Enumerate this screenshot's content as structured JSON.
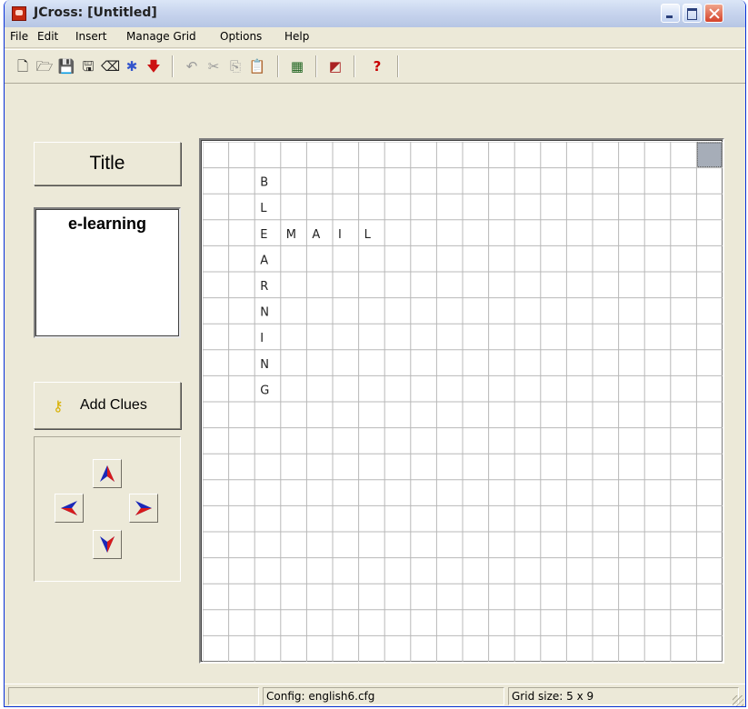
{
  "window": {
    "title": "JCross: [Untitled]"
  },
  "menu": [
    "File",
    "Edit",
    "Insert",
    "Manage Grid",
    "Options",
    "Help"
  ],
  "toolbar": {
    "icons": [
      "new-file-icon",
      "open-folder-icon",
      "save-icon",
      "save-as-icon",
      "eraser-icon",
      "web-export-icon",
      "export-arrow-icon",
      "undo-icon",
      "cut-icon",
      "copy-icon",
      "paste-icon",
      "grid-icon",
      "configuration-icon",
      "help-icon"
    ]
  },
  "left_panel": {
    "title_button": "Title",
    "title_value": "e-learning",
    "add_clues_label": "Add Clues",
    "arrows": [
      "up-arrow-icon",
      "left-arrow-icon",
      "right-arrow-icon",
      "down-arrow-icon"
    ]
  },
  "grid": {
    "rows": 20,
    "cols": 20,
    "letters": [
      {
        "r": 1,
        "c": 2,
        "ch": "B"
      },
      {
        "r": 2,
        "c": 2,
        "ch": "L"
      },
      {
        "r": 3,
        "c": 2,
        "ch": "E"
      },
      {
        "r": 3,
        "c": 3,
        "ch": "M"
      },
      {
        "r": 3,
        "c": 4,
        "ch": "A"
      },
      {
        "r": 3,
        "c": 5,
        "ch": "I"
      },
      {
        "r": 3,
        "c": 6,
        "ch": "L"
      },
      {
        "r": 4,
        "c": 2,
        "ch": "A"
      },
      {
        "r": 5,
        "c": 2,
        "ch": "R"
      },
      {
        "r": 6,
        "c": 2,
        "ch": "N"
      },
      {
        "r": 7,
        "c": 2,
        "ch": "I"
      },
      {
        "r": 8,
        "c": 2,
        "ch": "N"
      },
      {
        "r": 9,
        "c": 2,
        "ch": "G"
      }
    ],
    "selected": {
      "r": 0,
      "c": 19
    },
    "colors": {
      "line": "#b8b8b8",
      "selected": "#a6adb8"
    }
  },
  "status": {
    "pane1": "",
    "config": "Config: english6.cfg",
    "grid_size": "Grid size: 5 x 9"
  }
}
